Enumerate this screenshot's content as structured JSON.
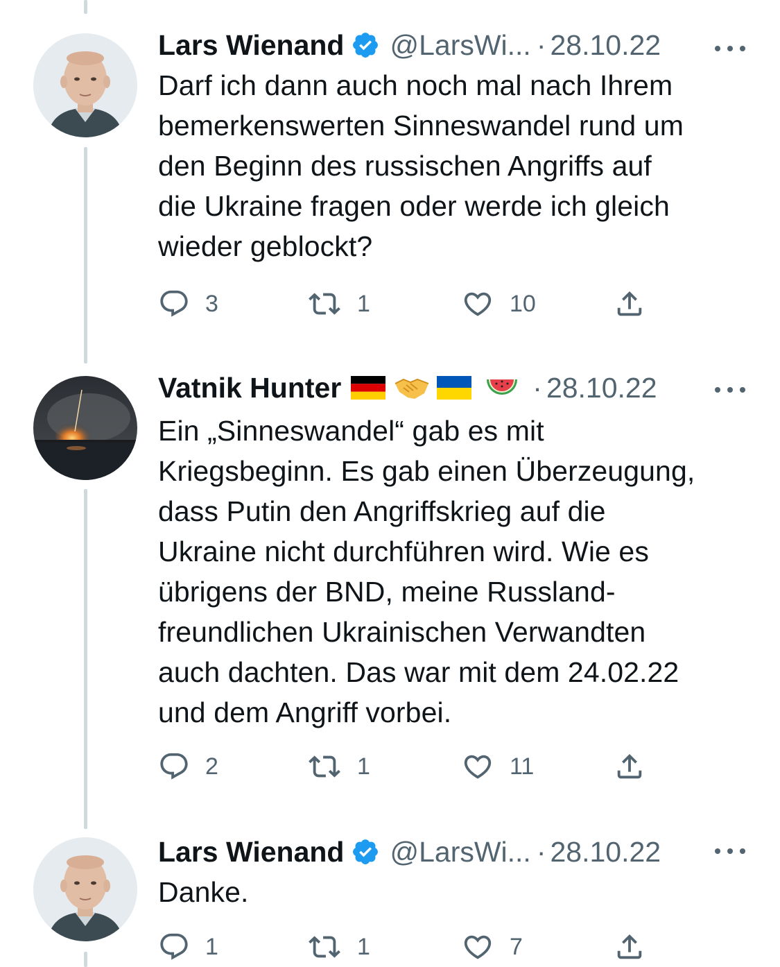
{
  "tweets": [
    {
      "name": "Lars Wienand",
      "handle": "@LarsWi...",
      "date": "28.10.22",
      "dot": "·",
      "verified": true,
      "text": "Darf ich dann auch noch mal nach Ihrem\nbemerkenswerten Sinneswandel rund um\nden Beginn des russischen Angriffs auf\ndie Ukraine fragen oder werde ich gleich\nwieder geblockt?",
      "replies": "3",
      "retweets": "1",
      "likes": "10"
    },
    {
      "name": "Vatnik Hunter",
      "date": "28.10.22",
      "dot": "·",
      "name_emojis": [
        "germany-flag",
        "handshake",
        "ukraine-flag",
        "watermelon"
      ],
      "text": "Ein „Sinneswandel“ gab es mit\nKriegsbeginn. Es gab einen Überzeugung,\ndass Putin den Angriffskrieg auf die\nUkraine nicht durchführen wird. Wie es\nübrigens der BND, meine Russland-\nfreundlichen Ukrainischen Verwandten\nauch dachten. Das war mit dem 24.02.22\nund dem Angriff vorbei.",
      "replies": "2",
      "retweets": "1",
      "likes": "11"
    },
    {
      "name": "Lars Wienand",
      "handle": "@LarsWi...",
      "date": "28.10.22",
      "dot": "·",
      "verified": true,
      "text": "Danke.",
      "replies": "1",
      "retweets": "1",
      "likes": "7"
    }
  ],
  "icons": [
    "reply-icon",
    "retweet-icon",
    "like-icon",
    "share-icon",
    "more-icon",
    "verified-badge-icon"
  ],
  "colors": {
    "text": "#0f1419",
    "secondary": "#536471",
    "verified": "#1d9bf0",
    "thread_line": "#cfd9de"
  }
}
